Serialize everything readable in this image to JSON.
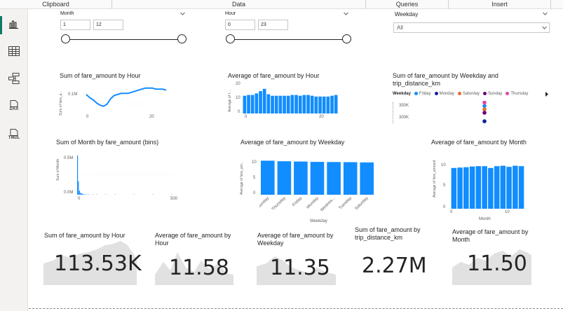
{
  "ribbon": {
    "groups": [
      {
        "label": "Clipboard",
        "width": 160
      },
      {
        "label": "Data",
        "width": 362
      },
      {
        "label": "Queries",
        "width": 118
      },
      {
        "label": "Insert",
        "width": 146
      }
    ]
  },
  "rail": {
    "dax_label": "DAX",
    "tmdl_label": "TMDL"
  },
  "slicers": {
    "month": {
      "title": "Month",
      "min": "1",
      "max": "12"
    },
    "hour": {
      "title": "Hour",
      "min": "0",
      "max": "23"
    },
    "weekday": {
      "title": "Weekday",
      "selected": "All"
    }
  },
  "visuals": {
    "sum_fare_by_hour": {
      "title": "Sum of fare_amount by Hour",
      "ylabel": "Sum of fare_a...",
      "y_tick": "0.1M",
      "x_ticks": [
        "0",
        "20"
      ]
    },
    "avg_fare_by_hour": {
      "title": "Average of fare_amount by Hour",
      "ylabel": "Average of f...",
      "y_ticks": [
        "20",
        "10",
        "0"
      ],
      "x_ticks": [
        "0",
        "20"
      ]
    },
    "sum_fare_by_weekday_dist": {
      "title": "Sum of fare_amount by Weekday and trip_distance_km",
      "legend_label": "Weekday",
      "legend_items": [
        {
          "label": "Friday",
          "color": "#118dff"
        },
        {
          "label": "Monday",
          "color": "#12239e"
        },
        {
          "label": "Saturday",
          "color": "#e66c37"
        },
        {
          "label": "Sunday",
          "color": "#6b007b"
        },
        {
          "label": "Thursday",
          "color": "#e044a7"
        }
      ],
      "y_ticks": [
        "350K",
        "300K"
      ]
    },
    "sum_month_by_fare_bins": {
      "title": "Sum of Month by fare_amount (bins)",
      "ylabel": "Sum of Month",
      "y_ticks": [
        "0.5M",
        "0.0M"
      ],
      "x_ticks": [
        "0",
        "500"
      ]
    },
    "avg_fare_by_weekday": {
      "title": "Average of fare_amount by Weekday",
      "ylabel": "Average of fare_am...",
      "y_ticks": [
        "10",
        "5",
        "0"
      ],
      "xlabel": "Weekday"
    },
    "avg_fare_by_month": {
      "title": "Average of fare_amount by Month",
      "ylabel": "Average of fare_amount",
      "y_ticks": [
        "10",
        "5",
        "0"
      ],
      "x_ticks": [
        "0",
        "10"
      ],
      "xlabel": "Month"
    }
  },
  "cards": [
    {
      "title": "Sum of fare_amount by Hour",
      "value": "113.53K"
    },
    {
      "title": "Average of fare_amount by Hour",
      "value": "11.58"
    },
    {
      "title": "Average of fare_amount by Weekday",
      "value": "11.35"
    },
    {
      "title": "Sum of fare_amount by trip_distance_km",
      "value": "2.27M"
    },
    {
      "title": "Average of fare_amount by Month",
      "value": "11.50"
    }
  ],
  "colors": {
    "accent": "#118dff",
    "rail_active": "#117865"
  },
  "chart_data": [
    {
      "type": "line",
      "title": "Sum of fare_amount by Hour",
      "ylabel": "Sum of fare_a...",
      "x": [
        0,
        1,
        2,
        3,
        4,
        5,
        6,
        7,
        8,
        9,
        10,
        11,
        12,
        13,
        14,
        15,
        16,
        17,
        18,
        19,
        20,
        21,
        22,
        23
      ],
      "values": [
        0.095,
        0.08,
        0.07,
        0.055,
        0.045,
        0.04,
        0.05,
        0.075,
        0.09,
        0.095,
        0.1,
        0.1,
        0.1,
        0.105,
        0.11,
        0.115,
        0.12,
        0.125,
        0.125,
        0.125,
        0.12,
        0.12,
        0.12,
        0.115
      ],
      "ylim": [
        0,
        0.15
      ]
    },
    {
      "type": "bar",
      "title": "Average of fare_amount by Hour",
      "ylabel": "Average of f...",
      "categories": [
        "0",
        "1",
        "2",
        "3",
        "4",
        "5",
        "6",
        "7",
        "8",
        "9",
        "10",
        "11",
        "12",
        "13",
        "14",
        "15",
        "16",
        "17",
        "18",
        "19",
        "20",
        "21",
        "22",
        "23"
      ],
      "values": [
        11.5,
        12,
        12,
        13,
        14.5,
        16,
        12.5,
        11.5,
        11.5,
        11.5,
        11.5,
        11.5,
        12,
        12,
        11.5,
        12,
        12,
        11.5,
        11,
        11,
        11,
        11,
        11.5,
        12
      ],
      "ylim": [
        0,
        20
      ]
    },
    {
      "type": "scatter",
      "title": "Sum of fare_amount by Weekday and trip_distance_km",
      "series": [
        {
          "name": "Friday",
          "values": [
            345000
          ]
        },
        {
          "name": "Monday",
          "values": [
            300000
          ]
        },
        {
          "name": "Saturday",
          "values": [
            335000
          ]
        },
        {
          "name": "Sunday",
          "values": [
            325000
          ]
        },
        {
          "name": "Thursday",
          "values": [
            355000
          ]
        }
      ],
      "ylim": [
        290000,
        360000
      ]
    },
    {
      "type": "bar",
      "title": "Sum of Month by fare_amount (bins)",
      "ylabel": "Sum of Month",
      "x": [
        0,
        5,
        10,
        15,
        20,
        25,
        30,
        40,
        50,
        60,
        80,
        100,
        150,
        200,
        300,
        400,
        500
      ],
      "values": [
        0.58,
        0.2,
        0.06,
        0.03,
        0.02,
        0.015,
        0.01,
        0.008,
        0.006,
        0.004,
        0.003,
        0.002,
        0.001,
        0.001,
        0.0005,
        0.0003,
        0.0002
      ],
      "ylim": [
        0,
        0.6
      ]
    },
    {
      "type": "bar",
      "title": "Average of fare_amount by Weekday",
      "ylabel": "Average of fare_am...",
      "xlabel": "Weekday",
      "categories": [
        "Sunday",
        "Thursday",
        "Friday",
        "Monday",
        "Wednes...",
        "Tuesday",
        "Saturday"
      ],
      "values": [
        11.7,
        11.5,
        11.4,
        11.3,
        11.25,
        11.2,
        11.1
      ],
      "ylim": [
        0,
        13
      ]
    },
    {
      "type": "bar",
      "title": "Average of fare_amount by Month",
      "ylabel": "Average of fare_amount",
      "xlabel": "Month",
      "categories": [
        "1",
        "2",
        "3",
        "4",
        "5",
        "6",
        "7",
        "8",
        "9",
        "10",
        "11",
        "12"
      ],
      "values": [
        11.2,
        11.3,
        11.4,
        11.6,
        11.7,
        11.7,
        11.2,
        11.7,
        11.8,
        11.5,
        11.8,
        11.7
      ],
      "ylim": [
        0,
        15
      ]
    }
  ]
}
